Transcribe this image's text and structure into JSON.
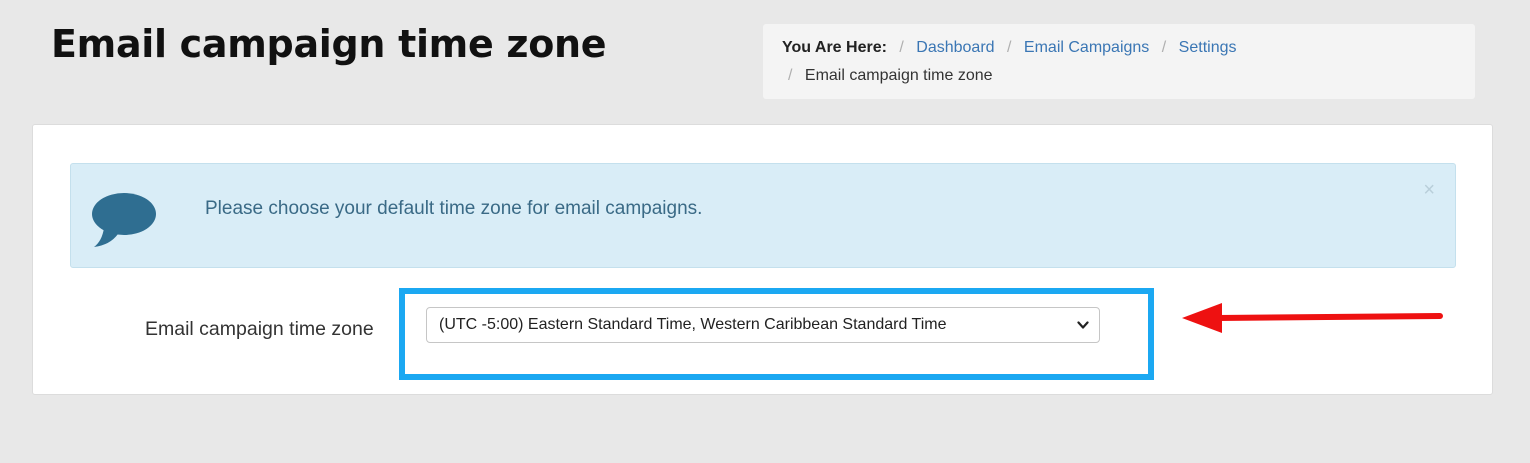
{
  "header": {
    "title": "Email campaign time zone"
  },
  "breadcrumb": {
    "lead": "You Are Here:",
    "separator": "/",
    "items": [
      {
        "label": "Dashboard"
      },
      {
        "label": "Email Campaigns"
      },
      {
        "label": "Settings"
      }
    ],
    "current": "Email campaign time zone"
  },
  "alert": {
    "icon": "chat-bubble-icon",
    "message": "Please choose your default time zone for email campaigns.",
    "close_label": "×"
  },
  "form": {
    "timezone_label": "Email campaign time zone",
    "timezone_value": "(UTC -5:00) Eastern Standard Time, Western Caribbean Standard Time"
  },
  "annotations": {
    "highlight_color": "#1ba8f2",
    "arrow_color": "#ee1111"
  }
}
